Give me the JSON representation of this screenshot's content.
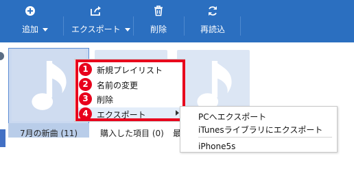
{
  "toolbar": {
    "add_label": "追加",
    "export_label": "エクスポート",
    "delete_label": "削除",
    "reload_label": "再読込"
  },
  "playlists": [
    {
      "title": "7月の新曲 (11)",
      "selected": true
    },
    {
      "title": "購入した項目 (0)"
    },
    {
      "title": "最"
    }
  ],
  "context_menu": {
    "items": [
      {
        "num": "1",
        "label": "新規プレイリスト"
      },
      {
        "num": "2",
        "label": "名前の変更"
      },
      {
        "num": "3",
        "label": "削除"
      },
      {
        "num": "4",
        "label": "エクスポート"
      }
    ]
  },
  "submenu": {
    "items": [
      "PCへエクスポート",
      "iTunesライブラリにエクスポート",
      "iPhone5s"
    ]
  },
  "colors": {
    "toolbar_bg": "#2b6fc0",
    "highlight_red": "#e8001c",
    "card_bg": "#dce6f4"
  },
  "icons": {
    "add": "plus-circle-icon",
    "export": "share-icon",
    "delete": "trash-icon",
    "reload": "refresh-icon",
    "note": "music-note-icon"
  }
}
